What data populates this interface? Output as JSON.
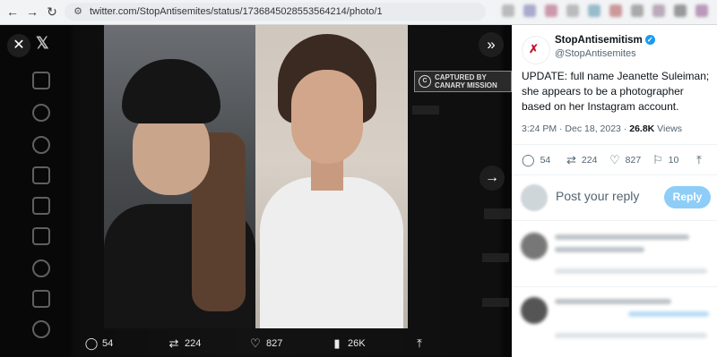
{
  "browser": {
    "url": "twitter.com/StopAntisemites/status/1736845028553564214/photo/1",
    "back_glyph": "←",
    "forward_glyph": "→",
    "reload_glyph": "↻",
    "site_info_glyph": "⚙"
  },
  "viewer": {
    "close_glyph": "✕",
    "x_logo": "𝕏",
    "collapse_glyph": "»",
    "next_glyph": "→",
    "watermark": "CAPTURED BY CANARY MISSION",
    "watermark_logo": "C",
    "actions": [
      {
        "icon": "reply-icon",
        "glyph": "◯",
        "label": "54"
      },
      {
        "icon": "retweet-icon",
        "glyph": "⇄",
        "label": "224"
      },
      {
        "icon": "like-icon",
        "glyph": "♡",
        "label": "827"
      },
      {
        "icon": "views-icon",
        "glyph": "▮",
        "label": "26K"
      },
      {
        "icon": "share-icon",
        "glyph": "⤒",
        "label": ""
      }
    ]
  },
  "tweet": {
    "display_name": "StopAntisemitism",
    "verified_glyph": "✓",
    "handle": "@StopAntisemites",
    "text": "UPDATE: full name Jeanette Suleiman; she appears to be a photographer based on her Instagram account.",
    "timestamp": "3:24 PM · Dec 18, 2023 · ",
    "views_count": "26.8K",
    "views_label": " Views",
    "stats": [
      {
        "icon": "reply-icon",
        "glyph": "◯",
        "label": "54"
      },
      {
        "icon": "retweet-icon",
        "glyph": "⇄",
        "label": "224"
      },
      {
        "icon": "like-icon",
        "glyph": "♡",
        "label": "827"
      },
      {
        "icon": "bookmark-icon",
        "glyph": "⚐",
        "label": "10"
      },
      {
        "icon": "share-icon",
        "glyph": "⤒",
        "label": ""
      }
    ],
    "reply_placeholder": "Post your reply",
    "reply_button": "Reply"
  },
  "colors": {
    "accent": "#1d9bf0",
    "reply_button": "#8ecdf8",
    "viewer_bg": "#000000"
  }
}
